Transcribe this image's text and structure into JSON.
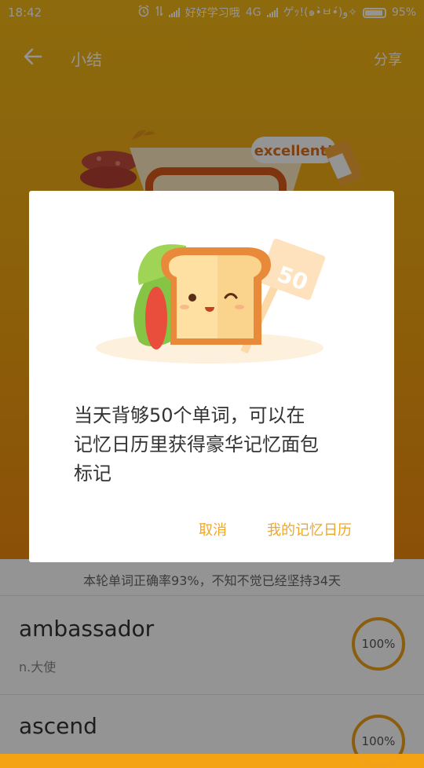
{
  "status_bar": {
    "time": "18:42",
    "carrier1": "好好学习哦",
    "network1": "4G",
    "carrier2": "ゲｯ!(๑•̀ㅂ•́)و✧",
    "battery": "95%"
  },
  "app_bar": {
    "title": "小结",
    "share": "分享"
  },
  "hero": {
    "badge": "excellent!"
  },
  "summary": {
    "text": "本轮单词正确率93%，不知不觉已经坚持34天"
  },
  "words": [
    {
      "word": "ambassador",
      "meaning": "n.大使",
      "progress": "100%"
    },
    {
      "word": "ascend",
      "meaning": "",
      "progress": "100%"
    }
  ],
  "dialog": {
    "sign_number": "50",
    "message_line1": "当天背够50个单词，可以在",
    "message_line2": "记忆日历里获得豪华记忆面包",
    "message_line3": "标记",
    "cancel": "取消",
    "calendar": "我的记忆日历"
  },
  "colors": {
    "accent": "#f0a726",
    "header_top": "#f3b817",
    "header_bottom": "#ef8a0d"
  }
}
